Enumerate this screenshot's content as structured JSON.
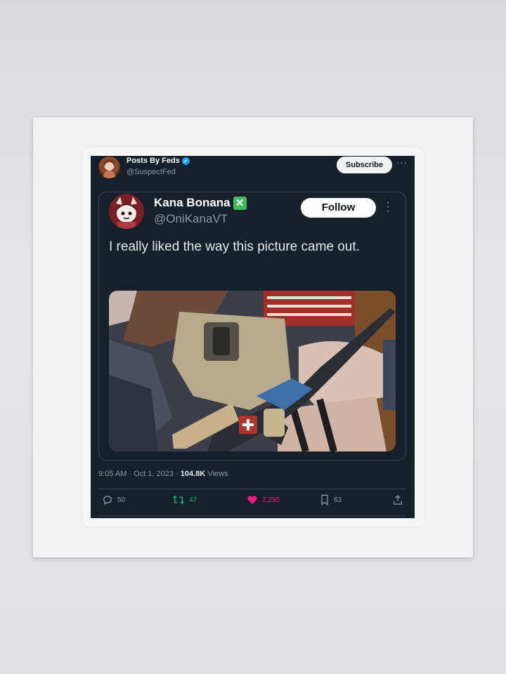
{
  "tweet": {
    "author": {
      "name": "Posts By Feds",
      "handle": "@SuspectFed",
      "verified": true,
      "avatar_icon": "profile-photo-avatar"
    },
    "subscribe_label": "Subscribe",
    "more_icon": "more-horizontal-icon",
    "quoted": {
      "name": "Kana Bonana",
      "handle": "@OniKanaVT",
      "badge_icon": "green-x-emoji",
      "follow_label": "Follow",
      "more_icon": "more-vertical-icon",
      "text": "I really liked the way this picture came out.",
      "media_description": "photo"
    },
    "timestamp": "9:05 AM · Oct 1, 2023 · ",
    "views_count": "104.8K",
    "views_label": " Views",
    "stats": {
      "replies": "50",
      "reposts": "47",
      "likes": "2,295",
      "bookmarks": "63"
    },
    "colors": {
      "background": "#15202b",
      "repost": "#00ba7c",
      "like": "#f91880",
      "verified": "#1d9bf0"
    }
  }
}
